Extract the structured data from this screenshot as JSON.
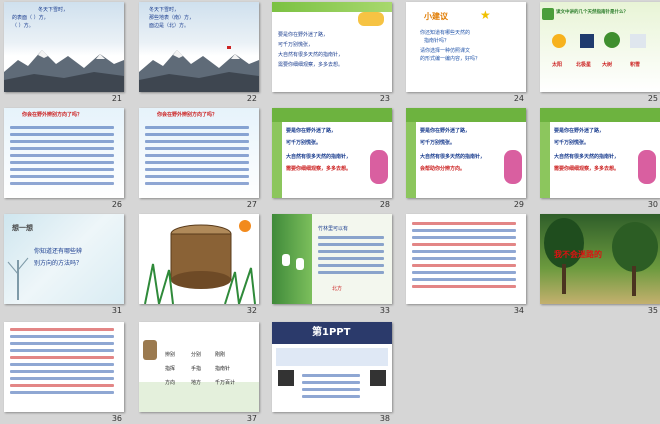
{
  "slides": [
    {
      "num": "21",
      "text": [
        "冬天下雪时，",
        "的表面（  ）方，",
        "（  ）方。"
      ]
    },
    {
      "num": "22",
      "text": [
        "冬天下雪时，",
        "那些地表（南）方，",
        "面边是（北）方。"
      ]
    },
    {
      "num": "23",
      "text": [
        "要是你在野外迷了路，",
        "可千万别慌张，",
        "大自然有很多天然的指南针，",
        "需要你细细观察，多多去想。"
      ]
    },
    {
      "num": "24",
      "text": [
        "小建议",
        "你还知道有哪些天然的",
        "指南针吗？",
        "请你选择一种仿照课文",
        "的形式编一编内容，好吗？"
      ]
    },
    {
      "num": "25",
      "text": [
        "读文中讲的几个天然指南针是什么？",
        "太阳",
        "北极星",
        "大树",
        "积雪"
      ]
    },
    {
      "num": "26",
      "text": [
        "你会在野外辨别方向了吗？"
      ]
    },
    {
      "num": "27",
      "text": [
        "你会在野外辨别方向了吗？"
      ]
    },
    {
      "num": "28",
      "text": [
        "要是你在野外迷了路，",
        "可千万别慌张。",
        "大自然有很多天然的指南针，",
        "需要你细细观察，多多去想。"
      ]
    },
    {
      "num": "29",
      "text": [
        "要是你在野外迷了路，",
        "可千万别慌张。",
        "大自然有很多天然的指南针，",
        "会帮助你分辨方向。"
      ]
    },
    {
      "num": "30",
      "text": [
        "要是你在野外迷了路，",
        "可千万别慌张。",
        "大自然有很多天然的指南针，",
        "需要你细细观察，多多去想。"
      ]
    },
    {
      "num": "31",
      "text": [
        "想一想",
        "你知道还有哪些辨",
        "别方向的方法吗？"
      ]
    },
    {
      "num": "32",
      "text": []
    },
    {
      "num": "33",
      "text": [
        "竹林里可以有",
        "北方"
      ]
    },
    {
      "num": "34",
      "text": []
    },
    {
      "num": "35",
      "text": [
        "我不会迷路的"
      ]
    },
    {
      "num": "36",
      "text": []
    },
    {
      "num": "37",
      "text": [
        "辨别",
        "分别",
        "刚刚",
        "指挥",
        "手指",
        "指南针",
        "方向",
        "地方",
        "千万百计"
      ]
    },
    {
      "num": "38",
      "text": [
        "第1PPT"
      ]
    }
  ]
}
